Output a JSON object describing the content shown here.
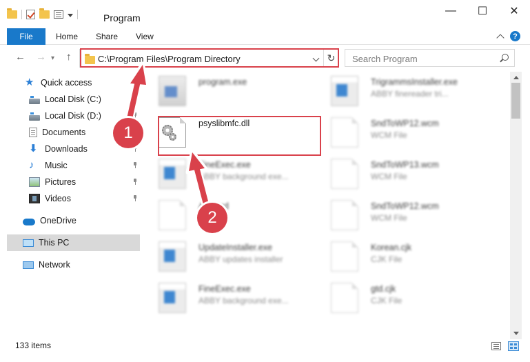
{
  "window": {
    "title": "Program",
    "controls": {
      "minimize": "—",
      "maximize": "☐",
      "close": "✕"
    }
  },
  "ribbon": {
    "tabs": [
      "File",
      "Home",
      "Share",
      "View"
    ],
    "help": "?"
  },
  "navbar": {
    "address": "C:\\Program Files\\Program Directory",
    "search_placeholder": "Search Program",
    "back": "←",
    "forward": "→",
    "up": "↑",
    "refresh": "↻"
  },
  "sidebar": {
    "items": [
      {
        "label": "Quick access",
        "icon": "star-icon"
      },
      {
        "label": "Local Disk (C:)",
        "icon": "disk-icon",
        "pinned": true
      },
      {
        "label": "Local Disk (D:)",
        "icon": "disk-icon",
        "pinned": true
      },
      {
        "label": "Documents",
        "icon": "documents-icon",
        "pinned": true
      },
      {
        "label": "Downloads",
        "icon": "downloads-icon",
        "pinned": true
      },
      {
        "label": "Music",
        "icon": "music-icon",
        "pinned": true
      },
      {
        "label": "Pictures",
        "icon": "pictures-icon",
        "pinned": true
      },
      {
        "label": "Videos",
        "icon": "videos-icon",
        "pinned": true
      },
      {
        "label": "OneDrive",
        "icon": "onedrive-icon"
      },
      {
        "label": "This PC",
        "icon": "this-pc-icon",
        "selected": true
      },
      {
        "label": "Network",
        "icon": "network-icon"
      }
    ]
  },
  "files": [
    {
      "name": "program.exe",
      "type": "",
      "icon": "exe-icon"
    },
    {
      "name": "TrigrammsInstaller.exe",
      "type": "ABBY finereader tri...",
      "icon": "app-icon"
    },
    {
      "name": "psyslibmfc.dll",
      "type": "",
      "icon": "dll-gear-icon"
    },
    {
      "name": "SndToWP12.wcm",
      "type": "WCM File",
      "icon": "document-icon"
    },
    {
      "name": "FineExec.exe",
      "type": "ABBY background exe...",
      "icon": "app-icon"
    },
    {
      "name": "SndToWP13.wcm",
      "type": "WCM File",
      "icon": "document-icon"
    },
    {
      "name": "Amberd",
      "type": "",
      "icon": "document-icon"
    },
    {
      "name": "SndToWP12.wcm",
      "type": "WCM File",
      "icon": "document-icon"
    },
    {
      "name": "UpdateInstaller.exe",
      "type": "ABBY updates installer",
      "icon": "app-icon"
    },
    {
      "name": "Korean.cjk",
      "type": "CJK File",
      "icon": "document-icon"
    },
    {
      "name": "FineExec.exe",
      "type": "ABBY background exe...",
      "icon": "app-icon"
    },
    {
      "name": "gtd.cjk",
      "type": "CJK File",
      "icon": "document-icon"
    }
  ],
  "status": {
    "item_count": "133 items"
  },
  "annotations": {
    "step1": "1",
    "step2": "2",
    "color": "#d9414b"
  },
  "colors": {
    "accent": "#1979ca",
    "highlight": "#d9414b",
    "selection": "#d9d9d9"
  }
}
